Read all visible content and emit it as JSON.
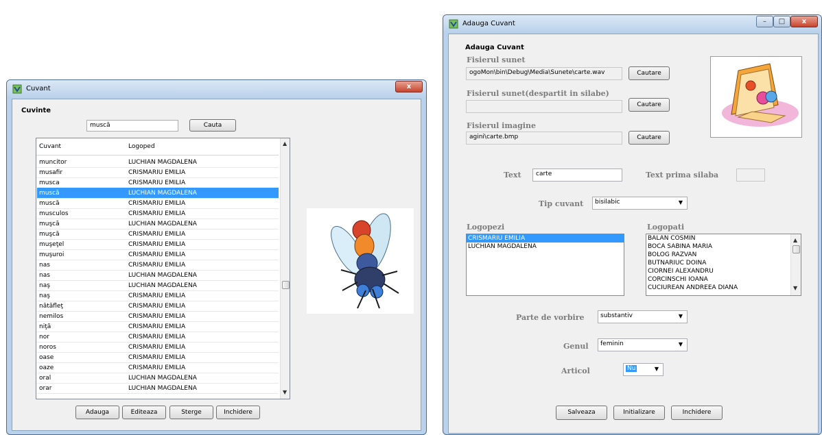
{
  "cuvant_window": {
    "title": "Cuvant",
    "close_label": "x",
    "group_title": "Cuvinte",
    "search": {
      "value": "muscă",
      "button_label": "Cauta"
    },
    "columns": [
      "Cuvant",
      "Logoped"
    ],
    "rows": [
      {
        "cuvant": "muncitor",
        "logoped": "LUCHIAN MAGDALENA",
        "selected": false
      },
      {
        "cuvant": "musafir",
        "logoped": "CRISMARIU EMILIA",
        "selected": false
      },
      {
        "cuvant": "musca",
        "logoped": "CRISMARIU EMILIA",
        "selected": false
      },
      {
        "cuvant": "muscă",
        "logoped": "LUCHIAN MAGDALENA",
        "selected": true
      },
      {
        "cuvant": "muscă",
        "logoped": "CRISMARIU EMILIA",
        "selected": false
      },
      {
        "cuvant": "musculos",
        "logoped": "CRISMARIU EMILIA",
        "selected": false
      },
      {
        "cuvant": "muşcă",
        "logoped": "LUCHIAN MAGDALENA",
        "selected": false
      },
      {
        "cuvant": "muşcă",
        "logoped": "CRISMARIU EMILIA",
        "selected": false
      },
      {
        "cuvant": "muşeţel",
        "logoped": "CRISMARIU EMILIA",
        "selected": false
      },
      {
        "cuvant": "muşuroi",
        "logoped": "CRISMARIU EMILIA",
        "selected": false
      },
      {
        "cuvant": "nas",
        "logoped": "CRISMARIU EMILIA",
        "selected": false
      },
      {
        "cuvant": "nas",
        "logoped": "LUCHIAN MAGDALENA",
        "selected": false
      },
      {
        "cuvant": "naş",
        "logoped": "LUCHIAN MAGDALENA",
        "selected": false
      },
      {
        "cuvant": "naş",
        "logoped": "CRISMARIU EMILIA",
        "selected": false
      },
      {
        "cuvant": "nătăfleţ",
        "logoped": "CRISMARIU EMILIA",
        "selected": false
      },
      {
        "cuvant": "nemilos",
        "logoped": "CRISMARIU EMILIA",
        "selected": false
      },
      {
        "cuvant": "niţă",
        "logoped": "CRISMARIU EMILIA",
        "selected": false
      },
      {
        "cuvant": "nor",
        "logoped": "CRISMARIU EMILIA",
        "selected": false
      },
      {
        "cuvant": "noros",
        "logoped": "CRISMARIU EMILIA",
        "selected": false
      },
      {
        "cuvant": "oase",
        "logoped": "CRISMARIU EMILIA",
        "selected": false
      },
      {
        "cuvant": "oaze",
        "logoped": "CRISMARIU EMILIA",
        "selected": false
      },
      {
        "cuvant": "oral",
        "logoped": "LUCHIAN MAGDALENA",
        "selected": false
      },
      {
        "cuvant": "orar",
        "logoped": "LUCHIAN MAGDALENA",
        "selected": false
      }
    ],
    "buttons": {
      "adauga": "Adauga",
      "editeaza": "Editeaza",
      "sterge": "Sterge",
      "inchidere": "Inchidere"
    },
    "image_icon": "fly-picture"
  },
  "adauga_window": {
    "title": "Adauga Cuvant",
    "controls": {
      "minimize": "–",
      "maximize": "□",
      "close": "x"
    },
    "group_title": "Adauga Cuvant",
    "fisier_sunet": {
      "label": "Fisierul sunet",
      "value": "ogoMon\\bin\\Debug\\Media\\Sunete\\carte.wav",
      "button_label": "Cautare"
    },
    "fisier_sunet_silabe": {
      "label": "Fisierul sunet(despartit in silabe)",
      "value": "",
      "button_label": "Cautare"
    },
    "fisier_imagine": {
      "label": "Fisierul imagine",
      "value": "agini\\carte.bmp",
      "button_label": "Cautare"
    },
    "text": {
      "label": "Text",
      "value": "carte"
    },
    "text_prima_silaba": {
      "label": "Text prima silaba",
      "value": ""
    },
    "tip_cuvant": {
      "label": "Tip cuvant",
      "value": "bisilabic"
    },
    "logopezi": {
      "label": "Logopezi",
      "items": [
        "CRISMARIU EMILIA",
        "LUCHIAN MAGDALENA"
      ],
      "selected_index": 0
    },
    "logopati": {
      "label": "Logopati",
      "items": [
        "BALAN  COSMIN",
        "BOCA SABINA MARIA",
        "BOLOG RAZVAN",
        "BUTNARIUC DOINA",
        "CIORNEI ALEXANDRU",
        "CORCINSCHI IOANA",
        "CUCIUREAN ANDREEA DIANA"
      ]
    },
    "parte_vorbire": {
      "label": "Parte de vorbire",
      "value": "substantiv"
    },
    "genul": {
      "label": "Genul",
      "value": "feminin"
    },
    "articol": {
      "label": "Articol",
      "value": "Nu"
    },
    "buttons": {
      "salveaza": "Salveaza",
      "initializare": "Initializare",
      "inchidere": "Inchidere"
    },
    "image_icon": "book-picture"
  }
}
